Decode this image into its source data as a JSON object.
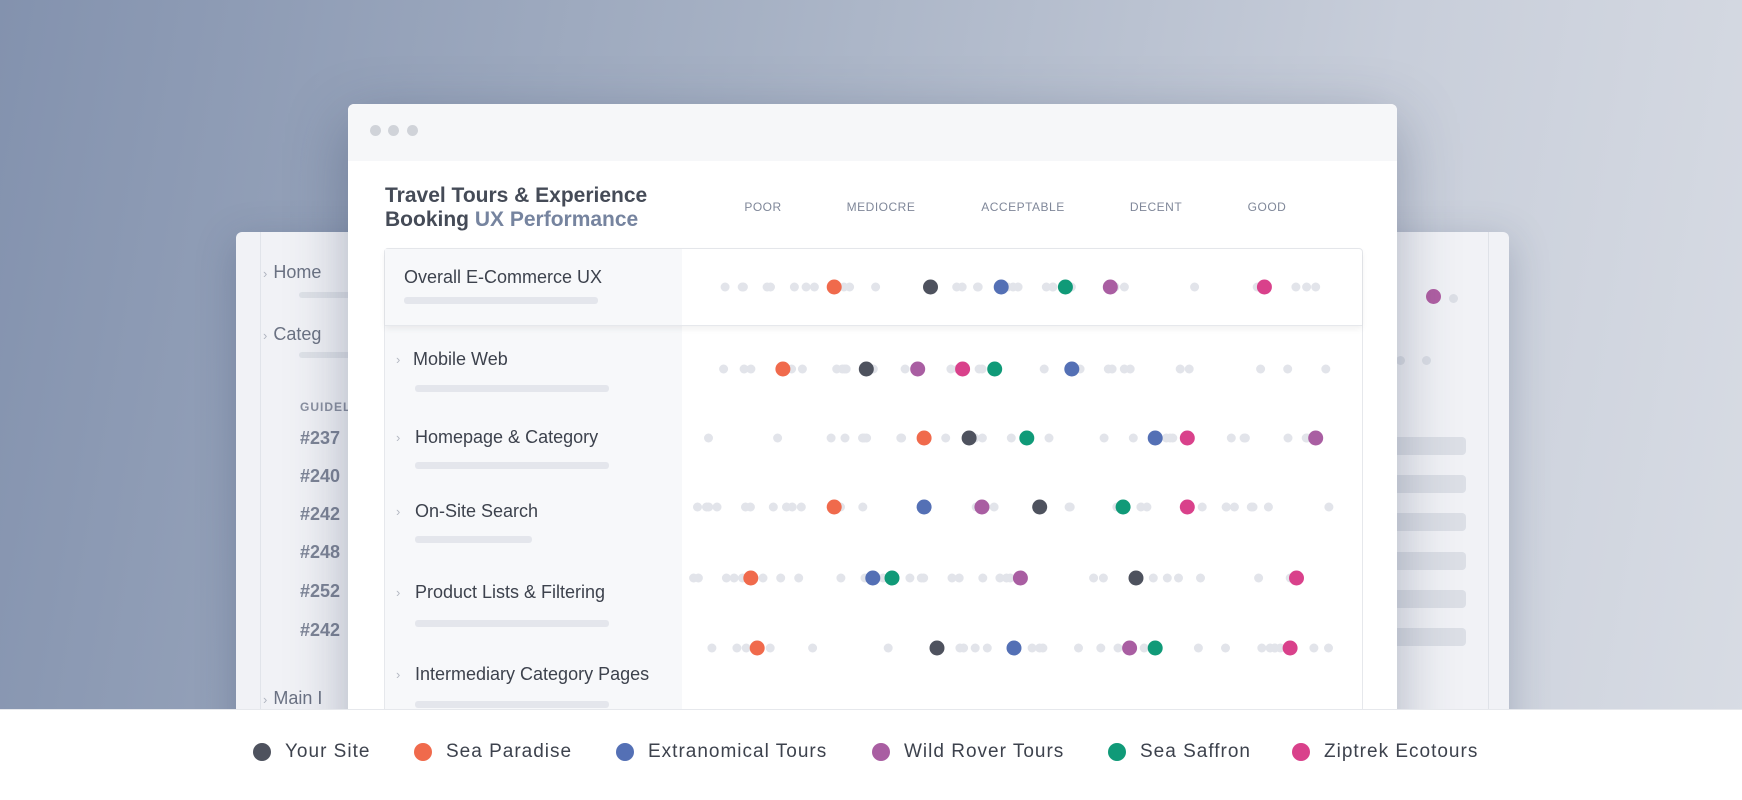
{
  "back_window": {
    "nav": [
      {
        "label": "Home"
      },
      {
        "label": "Categ"
      },
      {
        "label": "Main I"
      }
    ],
    "guidelines_heading": "GUIDEL",
    "guidelines": [
      "#237",
      "#240",
      "#242",
      "#248",
      "#252",
      "#242"
    ]
  },
  "main_window": {
    "title_line1": "Travel Tours & Experience",
    "title_line2_plain": "Booking",
    "title_line2_accent": "UX Performance"
  },
  "chart_data": {
    "type": "scatter",
    "title": "Travel Tours & Experience Booking UX Performance",
    "scale_categories": [
      "POOR",
      "MEDIOCRE",
      "ACCEPTABLE",
      "DECENT",
      "GOOD"
    ],
    "rows": [
      {
        "label": "Overall E-Commerce UX",
        "values": {
          "Your Site": 0.37,
          "Sea Paradise": 0.22,
          "Extranomical Tours": 0.48,
          "Wild Rover Tours": 0.65,
          "Sea Saffron": 0.58,
          "Ziptrek Ecotours": 0.89
        }
      },
      {
        "label": "Mobile Web",
        "values": {
          "Your Site": 0.27,
          "Sea Paradise": 0.14,
          "Extranomical Tours": 0.59,
          "Wild Rover Tours": 0.35,
          "Sea Saffron": 0.47,
          "Ziptrek Ecotours": 0.42
        }
      },
      {
        "label": "Homepage & Category",
        "values": {
          "Your Site": 0.43,
          "Sea Paradise": 0.36,
          "Extranomical Tours": 0.72,
          "Wild Rover Tours": 0.97,
          "Sea Saffron": 0.52,
          "Ziptrek Ecotours": 0.77
        }
      },
      {
        "label": "On-Site Search",
        "values": {
          "Your Site": 0.54,
          "Sea Paradise": 0.22,
          "Extranomical Tours": 0.36,
          "Wild Rover Tours": 0.45,
          "Sea Saffron": 0.67,
          "Ziptrek Ecotours": 0.77
        }
      },
      {
        "label": "Product Lists & Filtering",
        "values": {
          "Your Site": 0.69,
          "Sea Paradise": 0.09,
          "Extranomical Tours": 0.28,
          "Wild Rover Tours": 0.51,
          "Sea Saffron": 0.31,
          "Ziptrek Ecotours": 0.94
        }
      },
      {
        "label": "Intermediary Category Pages",
        "values": {
          "Your Site": 0.38,
          "Sea Paradise": 0.1,
          "Extranomical Tours": 0.5,
          "Wild Rover Tours": 0.68,
          "Sea Saffron": 0.72,
          "Ziptrek Ecotours": 0.93
        }
      }
    ],
    "series": [
      {
        "name": "Your Site",
        "color": "#4e525e"
      },
      {
        "name": "Sea Paradise",
        "color": "#f06a4c"
      },
      {
        "name": "Extranomical Tours",
        "color": "#5470b5"
      },
      {
        "name": "Wild Rover Tours",
        "color": "#a95ea2"
      },
      {
        "name": "Sea Saffron",
        "color": "#109a78"
      },
      {
        "name": "Ziptrek Ecotours",
        "color": "#d9418b"
      }
    ],
    "legend_position": "bottom"
  }
}
